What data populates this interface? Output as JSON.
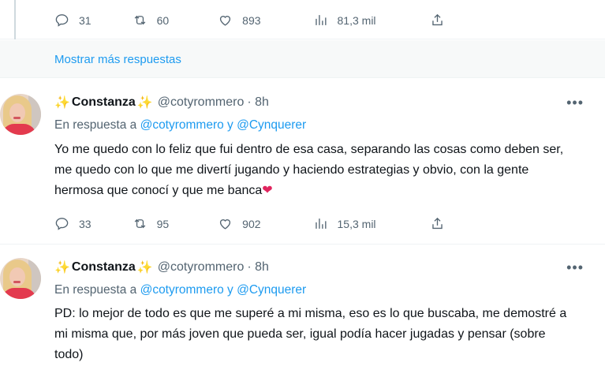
{
  "top_actions": {
    "replies": "31",
    "retweets": "60",
    "likes": "893",
    "views": "81,3 mil"
  },
  "show_more": "Mostrar más respuestas",
  "tweets": [
    {
      "sparkle_left": "✨",
      "name": "Constanza",
      "sparkle_right": "✨",
      "handle": "@cotyrommero",
      "time": "· 8h",
      "reply_prefix": "En respuesta a",
      "reply_mentions": "@cotyrommero y @Cynquerer",
      "text": "Yo me quedo con lo feliz que fui dentro de esa casa, separando las cosas como deben ser, me quedo con lo que me divertí jugando y haciendo estrategias y obvio, con la gente hermosa que conocí y que me banca",
      "emoji": "❤",
      "replies": "33",
      "retweets": "95",
      "likes": "902",
      "views": "15,3 mil"
    },
    {
      "sparkle_left": "✨",
      "name": "Constanza",
      "sparkle_right": "✨",
      "handle": "@cotyrommero",
      "time": "· 8h",
      "reply_prefix": "En respuesta a",
      "reply_mentions": "@cotyrommero y @Cynquerer",
      "text": "PD: lo mejor de todo es que me superé a mi misma, eso es lo que buscaba, me demostré a mi misma que, por más joven que pueda ser, igual podía hacer jugadas y pensar (sobre todo)"
    }
  ],
  "more_label": "•••",
  "colors": {
    "accent": "#1d9bf0",
    "secondary_text": "#536471",
    "heart": "#e0245e",
    "sparkle": "#f7b32b"
  },
  "icons": [
    "reply-icon",
    "retweet-icon",
    "like-icon",
    "views-icon",
    "share-icon",
    "more-icon"
  ]
}
